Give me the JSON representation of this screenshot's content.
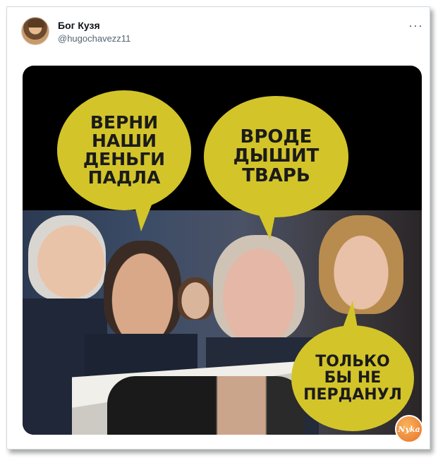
{
  "tweet": {
    "author_name": "Бог Кузя",
    "author_handle": "@hugochavezz11",
    "more_icon": "more-horizontal-icon",
    "more_glyph": "···"
  },
  "meme": {
    "bubble_1": "ВЕРНИ\nНАШИ\nДЕНЬГИ\nПАДЛА",
    "bubble_2": "ВРОДЕ\nДЫШИТ\nТВАРЬ",
    "bubble_3": "ТОЛЬКО\nБЫ НЕ\nПЕРДАНУЛ",
    "bubble_color": "#d3c42a"
  },
  "watermark": {
    "label": "Nyka",
    "colors": [
      "#f9b25b",
      "#e8732b"
    ]
  }
}
